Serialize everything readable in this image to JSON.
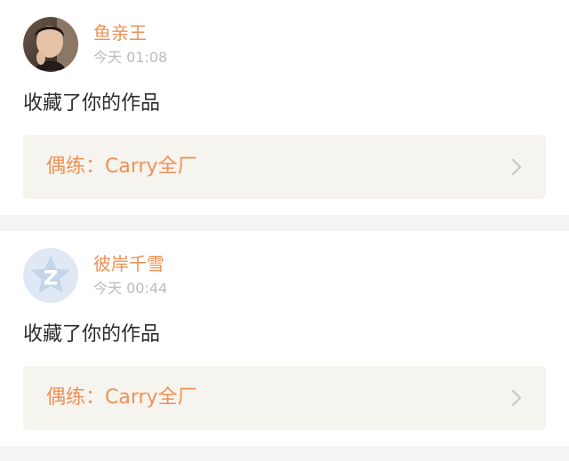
{
  "feed": {
    "items": [
      {
        "username": "鱼亲王",
        "timestamp": "今天 01:08",
        "action": "收藏了你的作品",
        "work_title": "偶练：Carry全厂",
        "avatar_icon": "user-photo-avatar",
        "link_icon": "chevron-right-icon"
      },
      {
        "username": "彼岸千雪",
        "timestamp": "今天 00:44",
        "action": "收藏了你的作品",
        "work_title": "偶练：Carry全厂",
        "avatar_icon": "default-star-avatar",
        "link_icon": "chevron-right-icon"
      }
    ]
  },
  "colors": {
    "accent": "#ee9156",
    "timestamp": "#bcbcbc",
    "text": "#2b2b2b",
    "link_bg": "#f5f4ee",
    "page_bg": "#f4f4f4",
    "default_avatar_bg": "#dfe8f4",
    "default_avatar_fg": "#c4d5ea"
  }
}
